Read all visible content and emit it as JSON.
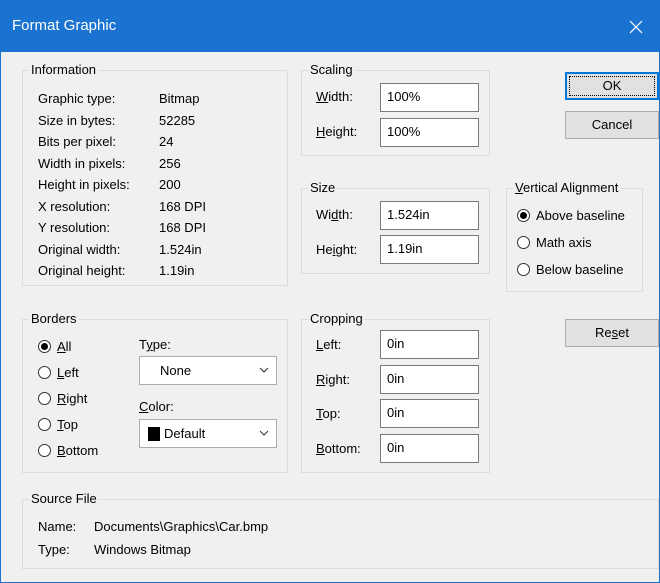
{
  "window": {
    "title": "Format Graphic"
  },
  "information": {
    "legend": "Information",
    "rows": [
      {
        "label": "Graphic type:",
        "value": "Bitmap"
      },
      {
        "label": "Size in bytes:",
        "value": "52285"
      },
      {
        "label": "Bits per pixel:",
        "value": "24"
      },
      {
        "label": "Width in pixels:",
        "value": "256"
      },
      {
        "label": "Height in pixels:",
        "value": "200"
      },
      {
        "label": "X resolution:",
        "value": "168 DPI"
      },
      {
        "label": "Y resolution:",
        "value": "168 DPI"
      },
      {
        "label": "Original width:",
        "value": "1.524in"
      },
      {
        "label": "Original height:",
        "value": "1.19in"
      }
    ]
  },
  "scaling": {
    "legend": "Scaling",
    "width": {
      "mnemonic": "W",
      "rest": "idth:",
      "value": "100%"
    },
    "height": {
      "mnemonic": "H",
      "rest": "eight:",
      "value": "100%"
    }
  },
  "size": {
    "legend": "Size",
    "width": {
      "pre": "Wi",
      "mnemonic": "d",
      "rest": "th:",
      "value": "1.524in"
    },
    "height": {
      "pre": "He",
      "mnemonic": "i",
      "rest": "ght:",
      "value": "1.19in"
    }
  },
  "vertical_alignment": {
    "legend_mnemonic": "V",
    "legend_rest": "ertical Alignment",
    "options": [
      {
        "label": "Above baseline",
        "checked": true
      },
      {
        "label": "Math axis",
        "checked": false
      },
      {
        "label": "Below baseline",
        "checked": false
      }
    ]
  },
  "buttons": {
    "ok": "OK",
    "cancel": "Cancel",
    "reset_pre": "Re",
    "reset_mnemonic": "s",
    "reset_rest": "et"
  },
  "borders": {
    "legend": "Borders",
    "options": [
      {
        "mnemonic": "A",
        "rest": "ll",
        "checked": true
      },
      {
        "mnemonic": "L",
        "rest": "eft",
        "checked": false
      },
      {
        "mnemonic": "R",
        "rest": "ight",
        "checked": false
      },
      {
        "mnemonic": "T",
        "rest": "op",
        "checked": false
      },
      {
        "mnemonic": "B",
        "rest": "ottom",
        "checked": false
      }
    ],
    "type_label_pre": "T",
    "type_label_mnemonic": "y",
    "type_label_rest": "pe:",
    "type_value": "None",
    "color_label_mnemonic": "C",
    "color_label_rest": "olor:",
    "color_value": "Default",
    "color_swatch": "#000000"
  },
  "cropping": {
    "legend": "Cropping",
    "left": {
      "mnemonic": "L",
      "rest": "eft:",
      "value": "0in"
    },
    "right": {
      "mnemonic": "R",
      "rest": "ight:",
      "value": "0in"
    },
    "top": {
      "mnemonic": "T",
      "rest": "op:",
      "value": "0in"
    },
    "bottom": {
      "mnemonic": "B",
      "rest": "ottom:",
      "value": "0in"
    }
  },
  "source_file": {
    "legend": "Source File",
    "name_label": "Name:",
    "name_value": "Documents\\Graphics\\Car.bmp",
    "type_label": "Type:",
    "type_value": "Windows Bitmap"
  },
  "colors": {
    "titlebar": "#1a73d1",
    "dialog_bg": "#f0f0f0",
    "focus_border": "#0078d7"
  }
}
